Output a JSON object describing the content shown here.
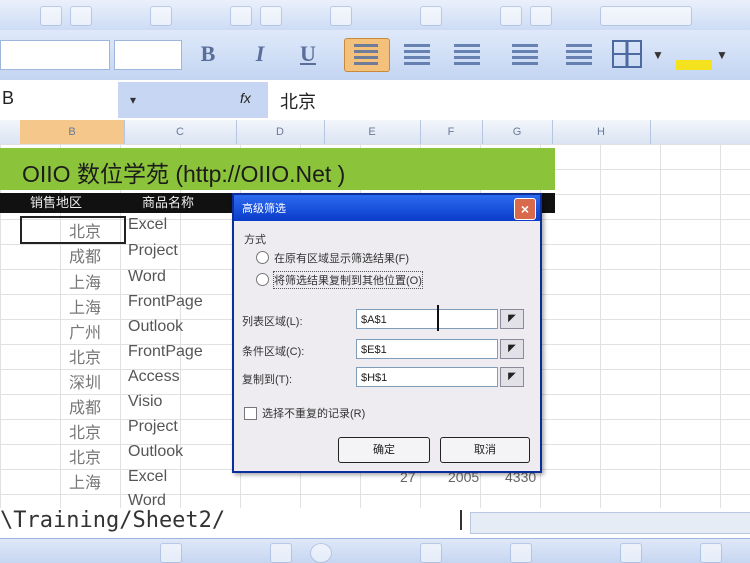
{
  "name_box": {
    "value": "B",
    "dropdown": "▾"
  },
  "fx_glyph": "fx",
  "formula_bar": {
    "value": "北京"
  },
  "format_toolbar": {
    "bold": "B",
    "italic": "I",
    "underline": "U"
  },
  "columns": [
    "B",
    "C",
    "D",
    "E",
    "F",
    "G",
    "H"
  ],
  "sheet": {
    "title": "OIIO 数位学苑 (http://OIIO.Net )",
    "headers": [
      "销售地区",
      "商品名称"
    ],
    "rows": [
      {
        "city": "北京",
        "product": "Excel",
        "v1": "",
        "v2": "",
        "v3": ""
      },
      {
        "city": "成都",
        "product": "Project",
        "v1": "",
        "v2": "",
        "v3": ""
      },
      {
        "city": "上海",
        "product": "Word",
        "v1": "",
        "v2": "",
        "v3": ""
      },
      {
        "city": "上海",
        "product": "FrontPage",
        "v1": "",
        "v2": "",
        "v3": ""
      },
      {
        "city": "广州",
        "product": "Outlook",
        "v1": "",
        "v2": "",
        "v3": ""
      },
      {
        "city": "北京",
        "product": "FrontPage",
        "v1": "",
        "v2": "",
        "v3": ""
      },
      {
        "city": "深圳",
        "product": "Access",
        "v1": "",
        "v2": "",
        "v3": ""
      },
      {
        "city": "成都",
        "product": "Visio",
        "v1": "",
        "v2": "",
        "v3": ""
      },
      {
        "city": "北京",
        "product": "Project",
        "v1": "",
        "v2": "",
        "v3": ""
      },
      {
        "city": "北京",
        "product": "Outlook",
        "v1": "",
        "v2": "",
        "v3": ""
      },
      {
        "city": "上海",
        "product": "Excel",
        "v1": "27",
        "v2": "2005",
        "v3": "4330"
      },
      {
        "city": "",
        "product": "Word",
        "v1": "",
        "v2": "",
        "v3": ""
      }
    ]
  },
  "dialog": {
    "title": "高级筛选",
    "close": "×",
    "group_label": "方式",
    "option1": "在原有区域显示筛选结果(F)",
    "option2": "将筛选结果复制到其他位置(O)",
    "list_range_label": "列表区域(L):",
    "list_range_value": "$A$1",
    "criteria_label": "条件区域(C):",
    "criteria_value": "$E$1",
    "copy_to_label": "复制到(T):",
    "copy_to_value": "$H$1",
    "unique_label": "选择不重复的记录(R)",
    "ok": "确定",
    "cancel": "取消"
  },
  "sheet_tabs": {
    "path": "\\Training/Sheet2/"
  }
}
